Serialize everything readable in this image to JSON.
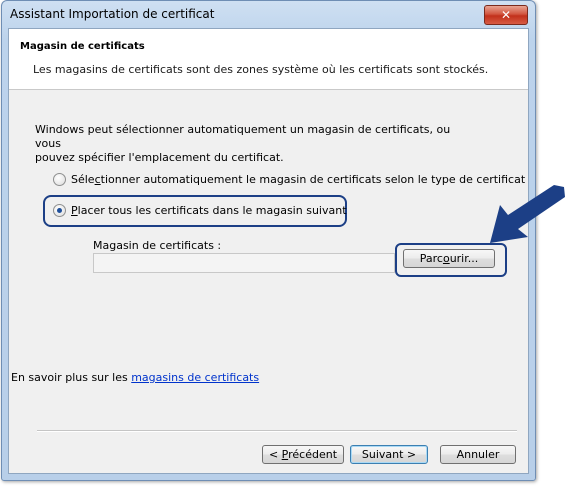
{
  "window": {
    "title": "Assistant Importation de certificat",
    "close_label": "✕"
  },
  "header": {
    "title": "Magasin de certificats",
    "description": "Les magasins de certificats sont des zones système où les certificats sont stockés."
  },
  "body": {
    "intro_line1": "Windows peut sélectionner automatiquement un magasin de certificats, ou vous",
    "intro_line2": "pouvez spécifier l'emplacement du certificat."
  },
  "options": {
    "auto": {
      "pre": "Séle",
      "accel": "c",
      "post": "tionner automatiquement le magasin de certificats selon le type de certificat",
      "selected": false
    },
    "manual": {
      "accel": "P",
      "post": "lacer tous les certificats dans le magasin suivant",
      "selected": true
    }
  },
  "store": {
    "label": "Magasin de certificats :",
    "value": ""
  },
  "browse_button": {
    "pre": "Parc",
    "accel": "o",
    "post": "urir..."
  },
  "learn_more": {
    "prefix": "En savoir plus sur les ",
    "link": "magasins de certificats"
  },
  "footer": {
    "back_prefix": "< ",
    "back_accel": "P",
    "back_post": "récédent",
    "next_label": "Suivant >",
    "cancel_label": "Annuler"
  },
  "colors": {
    "highlight": "#1c3f86",
    "link": "#0033cc",
    "close_button": "#c2301b",
    "arrow": "#1c3f86"
  },
  "icons": {
    "close": "close-icon",
    "arrow": "callout-arrow-icon"
  }
}
